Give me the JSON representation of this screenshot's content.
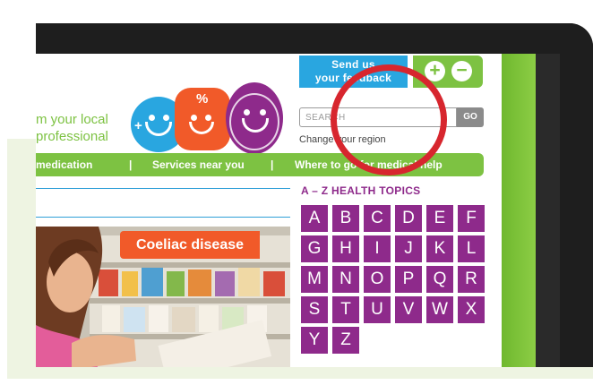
{
  "feedback": {
    "line1": "Send us",
    "line2": "your feedback"
  },
  "zoom": {
    "plus": "+",
    "minus": "−"
  },
  "tagline": {
    "line1": "m your local",
    "line2": "professional"
  },
  "search": {
    "placeholder": "SEARCH",
    "go_label": "GO",
    "region_link": "Change your region"
  },
  "nav": {
    "items": [
      "r medication",
      "Services near you",
      "Where to go for medical help"
    ],
    "separator": "|"
  },
  "az": {
    "title": "A – Z HEALTH TOPICS",
    "letters": [
      "A",
      "B",
      "C",
      "D",
      "E",
      "F",
      "G",
      "H",
      "I",
      "J",
      "K",
      "L",
      "M",
      "N",
      "O",
      "P",
      "Q",
      "R",
      "S",
      "T",
      "U",
      "V",
      "W",
      "X",
      "Y",
      "Z"
    ]
  },
  "feature": {
    "label": "Coeliac disease"
  },
  "faces": {
    "left_symbol": "+",
    "middle_symbol": "%"
  },
  "colors": {
    "brand_green": "#7dc242",
    "feedback_blue": "#29a6e0",
    "az_purple": "#8e2a8b",
    "highlight_red": "#d7262e",
    "feature_orange": "#f15a29"
  }
}
